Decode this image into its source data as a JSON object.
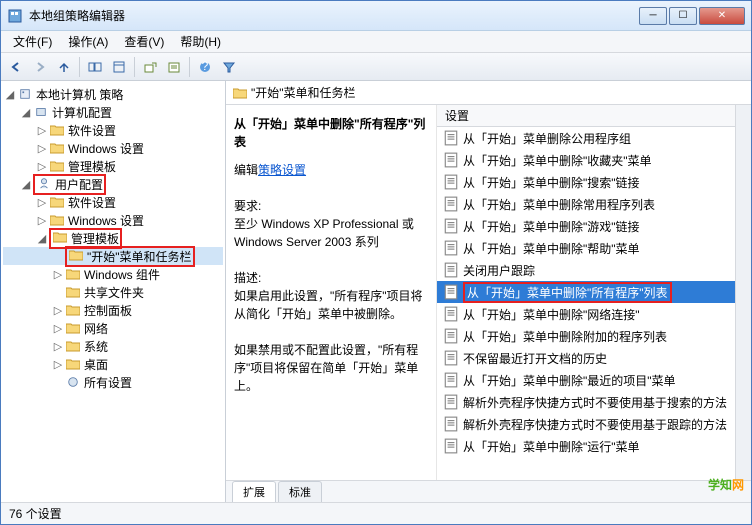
{
  "window": {
    "title": "本地组策略编辑器"
  },
  "menu": {
    "file": "文件(F)",
    "action": "操作(A)",
    "view": "查看(V)",
    "help": "帮助(H)"
  },
  "toolbar_icons": [
    "back",
    "forward",
    "up",
    "sep",
    "tree-view",
    "details",
    "sep",
    "export",
    "refresh",
    "sep",
    "help",
    "filter"
  ],
  "tree": {
    "root": "本地计算机 策略",
    "computer": "计算机配置",
    "comp_children": [
      "软件设置",
      "Windows 设置",
      "管理模板"
    ],
    "user": "用户配置",
    "user_children": {
      "soft": "软件设置",
      "win": "Windows 设置",
      "admin": "管理模板",
      "admin_children": {
        "start": "\"开始\"菜单和任务栏",
        "wincomp": "Windows 组件",
        "shared": "共享文件夹",
        "ctrl": "控制面板",
        "net": "网络",
        "sys": "系统",
        "desk": "桌面",
        "all": "所有设置"
      }
    }
  },
  "header": {
    "path": "\"开始\"菜单和任务栏"
  },
  "desc": {
    "title": "从「开始」菜单中删除\"所有程序\"列表",
    "edit_label": "编辑",
    "edit_link": "策略设置",
    "req_label": "要求:",
    "req_text": "至少 Windows XP Professional 或 Windows Server 2003 系列",
    "desc_label": "描述:",
    "desc_p1": "如果启用此设置，\"所有程序\"项目将从简化「开始」菜单中被删除。",
    "desc_p2": "如果禁用或不配置此设置，\"所有程序\"项目将保留在简单「开始」菜单上。"
  },
  "list": {
    "header": "设置",
    "items": [
      "从「开始」菜单删除公用程序组",
      "从「开始」菜单中删除\"收藏夹\"菜单",
      "从「开始」菜单中删除\"搜索\"链接",
      "从「开始」菜单中删除常用程序列表",
      "从「开始」菜单中删除\"游戏\"链接",
      "从「开始」菜单中删除\"帮助\"菜单",
      "关闭用户跟踪",
      "从「开始」菜单中删除\"所有程序\"列表",
      "从「开始」菜单中删除\"网络连接\"",
      "从「开始」菜单中删除附加的程序列表",
      "不保留最近打开文档的历史",
      "从「开始」菜单中删除\"最近的项目\"菜单",
      "解析外壳程序快捷方式时不要使用基于搜索的方法",
      "解析外壳程序快捷方式时不要使用基于跟踪的方法",
      "从「开始」菜单中删除\"运行\"菜单"
    ],
    "selected_index": 7
  },
  "tabs": {
    "extended": "扩展",
    "standard": "标准"
  },
  "status": {
    "count": "76 个设置"
  },
  "watermark": {
    "a": "学知",
    "b": "网"
  }
}
